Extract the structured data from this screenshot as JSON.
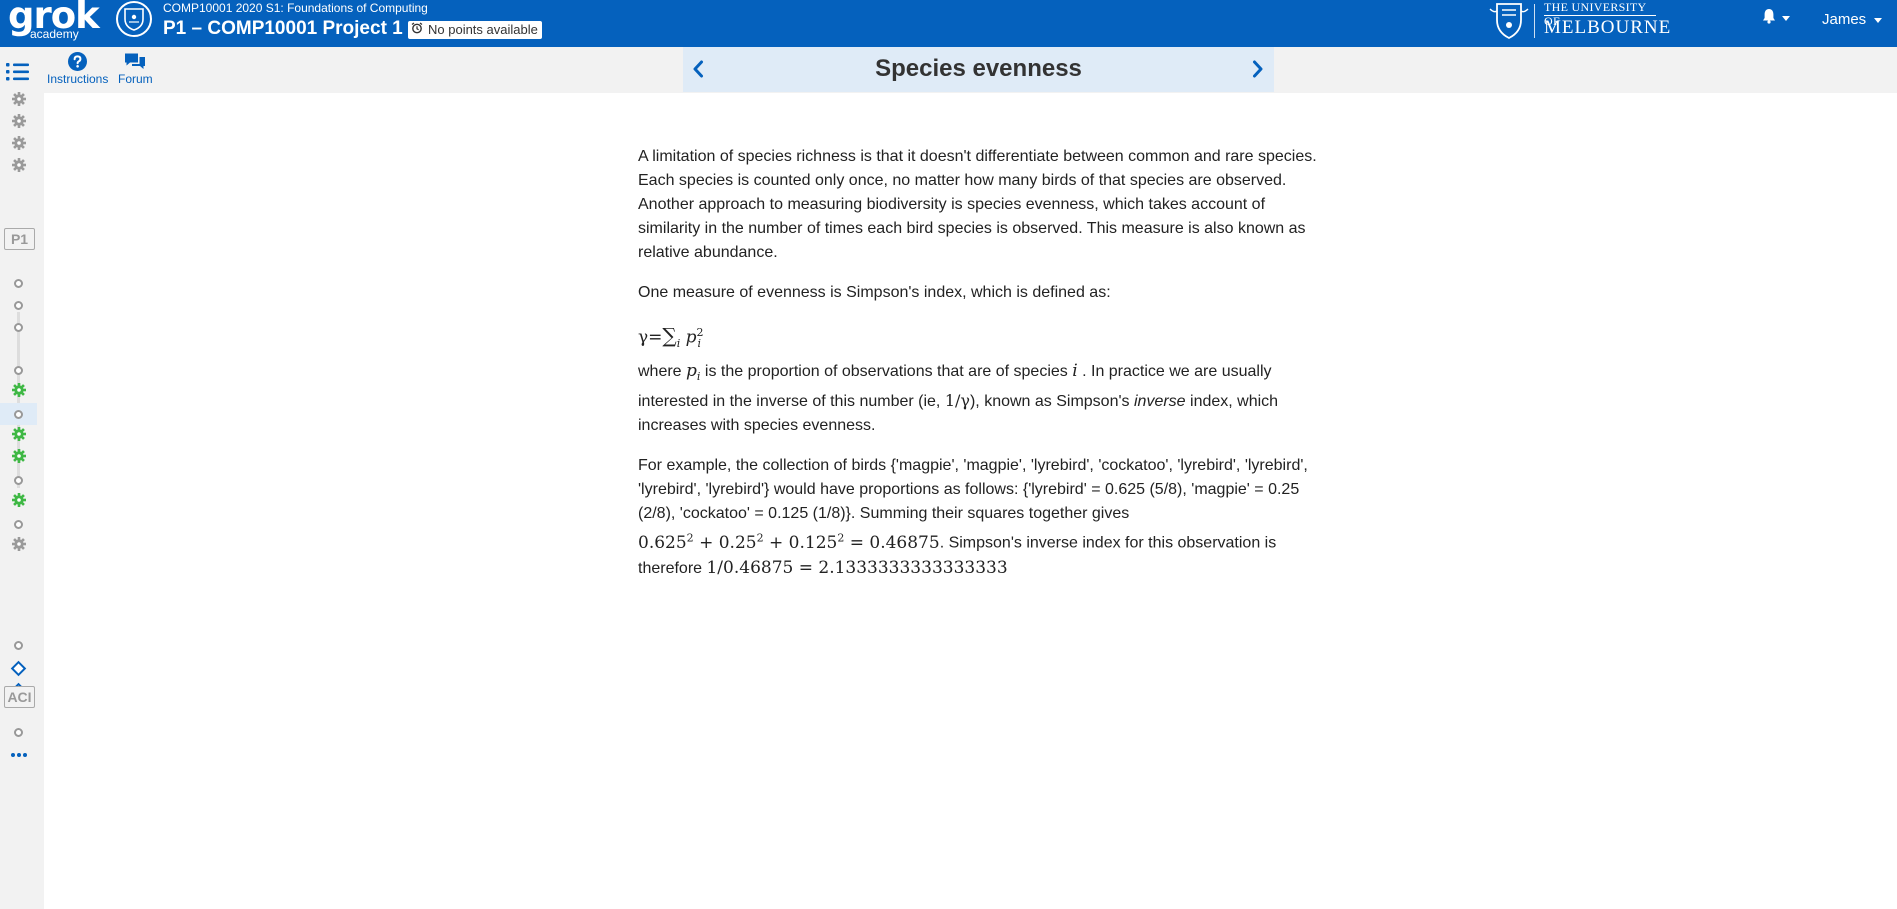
{
  "header": {
    "logo_main": "grok",
    "logo_sub": "academy",
    "course_name": "COMP10001 2020 S1: Foundations of Computing",
    "project_title": "P1 – COMP10001 Project 1",
    "points_badge": "No points available",
    "university_line1": "THE UNIVERSITY OF",
    "university_line2": "MELBOURNE",
    "user_name": "James",
    "brand_color": "#0561bd"
  },
  "toolbar": {
    "instructions_label": "Instructions",
    "forum_label": "Forum",
    "lesson_title": "Species evenness"
  },
  "sidebar": {
    "section_labels": [
      "P1",
      "ACI"
    ],
    "items": [
      {
        "icon": "gear-icon",
        "state": "grey"
      },
      {
        "icon": "gear-icon",
        "state": "grey"
      },
      {
        "icon": "gear-icon",
        "state": "grey"
      },
      {
        "icon": "gear-icon",
        "state": "grey"
      },
      {
        "icon": "ring-icon",
        "state": "incomplete"
      },
      {
        "icon": "ring-icon",
        "state": "incomplete"
      },
      {
        "icon": "ring-icon",
        "state": "incomplete"
      },
      {
        "icon": "ring-icon",
        "state": "incomplete"
      },
      {
        "icon": "gear-icon",
        "state": "complete"
      },
      {
        "icon": "ring-icon",
        "state": "current"
      },
      {
        "icon": "gear-icon",
        "state": "complete"
      },
      {
        "icon": "gear-icon",
        "state": "complete"
      },
      {
        "icon": "ring-icon",
        "state": "incomplete"
      },
      {
        "icon": "gear-icon",
        "state": "complete"
      },
      {
        "icon": "ring-icon",
        "state": "incomplete"
      },
      {
        "icon": "gear-icon",
        "state": "grey"
      },
      {
        "icon": "ring-icon",
        "state": "incomplete"
      },
      {
        "icon": "diamond-icon",
        "state": "blue"
      },
      {
        "icon": "diamond-icon",
        "state": "blue"
      },
      {
        "icon": "ring-icon",
        "state": "incomplete"
      },
      {
        "icon": "more-dots-icon",
        "state": "blue"
      }
    ]
  },
  "content": {
    "para1": "A limitation of species richness is that it doesn't differentiate between common and rare species. Each species is counted only once, no matter how many birds of that species are observed. Another approach to measuring biodiversity is species evenness, which takes account of similarity in the number of times each bird species is observed. This measure is also known as relative abundance.",
    "para2": "One measure of evenness is Simpson's index, which is defined as:",
    "formula": {
      "lhs": "γ",
      "eq": "=",
      "sum": "∑",
      "sum_index": "i",
      "term": "p",
      "term_sub": "i",
      "term_sup": "2"
    },
    "para3": {
      "t1": "where ",
      "var_p": "p",
      "var_p_sub": "i",
      "t2": " is the proportion of observations that are of species ",
      "var_i": "i",
      "t3": " . In practice we are usually interested in the inverse of this number (ie, ",
      "inv": "1/γ",
      "t4": "), known as Simpson's ",
      "emph": "inverse",
      "t5": " index, which increases with species evenness."
    },
    "para4": {
      "t1": "For example, the collection of birds {'magpie', 'magpie', 'lyrebird', 'cockatoo', 'lyrebird', 'lyrebird', 'lyrebird', 'lyrebird'} would have proportions as follows: {'lyrebird' = 0.625 (5/8), 'magpie' = 0.25 (2/8), 'cockatoo' = 0.125 (1/8)}. Summing their squares together gives",
      "m1": "0.625",
      "m2": "0.25",
      "m3": "0.125",
      "sq": "2",
      "plus": " + ",
      "result": " = 0.46875",
      "t2": ". Simpson's inverse index for this observation is therefore ",
      "m4": "1/0.46875 = 2.1333333333333333"
    }
  }
}
